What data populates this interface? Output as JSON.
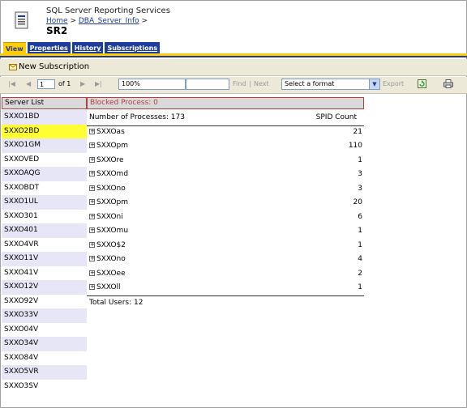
{
  "header": {
    "app_name": "SQL Server Reporting Services",
    "breadcrumb_home": "Home",
    "breadcrumb_sep1": " > ",
    "breadcrumb_folder": "DBA_Server_Info",
    "breadcrumb_sep2": " >",
    "report_title": "SR2"
  },
  "tabs": [
    {
      "label": "View",
      "active": true
    },
    {
      "label": "Properties",
      "active": false
    },
    {
      "label": "History",
      "active": false
    },
    {
      "label": "Subscriptions",
      "active": false
    }
  ],
  "subscription": {
    "new_label": "New Subscription"
  },
  "toolbar": {
    "page_value": "1",
    "of_label": "of 1",
    "zoom_value": "100%",
    "find_label": "Find",
    "separator": "|",
    "next_label": "Next",
    "format_placeholder": "Select a format",
    "export_label": "Export"
  },
  "report": {
    "server_list_header": "Server List",
    "blocked_header": "Blocked Process: 0",
    "num_processes_label": "Number of Processes: 173",
    "spid_count_label": "SPID Count",
    "total_users_label": "Total Users: 12",
    "servers": [
      "SXXO1BD",
      "SXXO2BD",
      "SXXO1GM",
      "SXXOVED",
      "SXXOAQG",
      "SXXOBDT",
      "SXXO1UL",
      "SXXO301",
      "SXXO401",
      "SXXO4VR",
      "SXXO11V",
      "SXXO41V",
      "SXXO12V",
      "SXXO92V",
      "SXXO33V",
      "SXXO04V",
      "SXXO34V",
      "SXXO84V",
      "SXXO5VR",
      "SXXO3SV"
    ],
    "selected_server_index": 1,
    "processes": [
      {
        "name": "SXXOas",
        "count": "21"
      },
      {
        "name": "SXXOpm",
        "count": "110"
      },
      {
        "name": "SXXOre",
        "count": "1"
      },
      {
        "name": "SXXOmd",
        "count": "3"
      },
      {
        "name": "SXXOno",
        "count": "3"
      },
      {
        "name": "SXXOpm",
        "count": "20"
      },
      {
        "name": "SXXOni",
        "count": "6"
      },
      {
        "name": "SXXOmu",
        "count": "1"
      },
      {
        "name": "SXXO$2",
        "count": "1"
      },
      {
        "name": "SXXOno",
        "count": "4"
      },
      {
        "name": "SXXOee",
        "count": "2"
      },
      {
        "name": "SXXOll",
        "count": "1"
      }
    ]
  },
  "colors": {
    "tab_blue": "#1c3d9b",
    "tab_yellow": "#ffcc00",
    "selected_row": "#ffff33",
    "header_border": "#b04040"
  }
}
